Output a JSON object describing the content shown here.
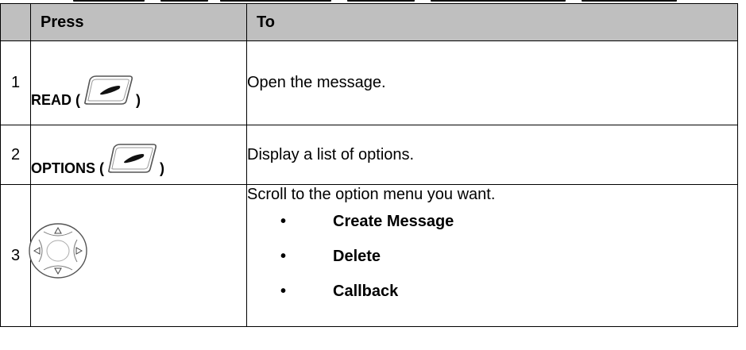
{
  "table": {
    "headers": {
      "number": "",
      "press": "Press",
      "to": "To"
    },
    "rows": [
      {
        "number": "1",
        "press_label": "READ (",
        "press_suffix": ")",
        "press_icon": "soft-key-icon",
        "to": "Open the message."
      },
      {
        "number": "2",
        "press_label": "OPTIONS (",
        "press_suffix": ")",
        "press_icon": "soft-key-icon",
        "to": "Display a list of options."
      },
      {
        "number": "3",
        "press_icon": "navigation-key-icon",
        "to": "Scroll to the option menu you want.",
        "options": [
          "Create Message",
          "Delete",
          "Callback"
        ],
        "bullet": "•"
      }
    ]
  },
  "colors": {
    "header_background": "#bfbfbf",
    "border": "#000000",
    "text": "#000000"
  }
}
